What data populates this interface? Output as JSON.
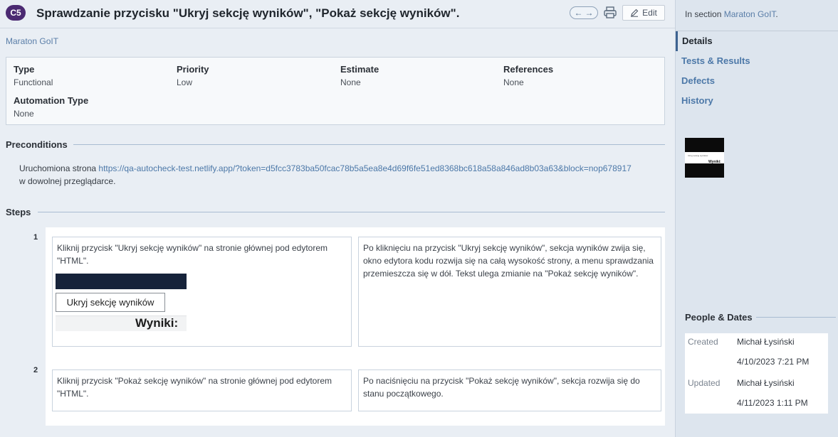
{
  "header": {
    "badge": "C5",
    "title": "Sprawdzanie przycisku \"Ukryj sekcję wyników\", \"Pokaż sekcję wyników\".",
    "edit_label": "Edit",
    "prev_arrow": "←",
    "next_arrow": "→"
  },
  "breadcrumb": "Maraton GoIT",
  "fields": {
    "type_label": "Type",
    "type_value": "Functional",
    "priority_label": "Priority",
    "priority_value": "Low",
    "estimate_label": "Estimate",
    "estimate_value": "None",
    "references_label": "References",
    "references_value": "None",
    "automation_label": "Automation Type",
    "automation_value": "None"
  },
  "preconditions": {
    "heading": "Preconditions",
    "text_before": "Uruchomiona strona ",
    "link": "https://qa-autocheck-test.netlify.app/?token=d5fcc3783ba50fcac78b5a5ea8e4d69f6fe51ed8368bc618a58a846ad8b03a63&block=nop678917",
    "text_after": " w dowolnej przeglądarce."
  },
  "steps": {
    "heading": "Steps",
    "items": [
      {
        "number": "1",
        "action": "Kliknij przycisk \"Ukryj sekcję wyników\" na stronie głównej pod edytorem \"HTML\".",
        "image_button": "Ukryj sekcję wyników",
        "image_label": "Wyniki:",
        "expected": "Po kliknięciu na przycisk \"Ukryj sekcję wyników\", sekcja wyników zwija się, okno edytora kodu rozwija się na całą wysokość strony, a menu sprawdzania przemieszcza się w dół. Tekst ulega zmianie na \"Pokaż sekcję wyników\"."
      },
      {
        "number": "2",
        "action": "Kliknij przycisk \"Pokaż sekcję wyników\" na stronie głównej pod edytorem \"HTML\".",
        "expected": "Po naciśnięciu na przycisk \"Pokaż sekcję wyników\", sekcja rozwija się do stanu początkowego."
      }
    ]
  },
  "sidebar": {
    "in_section_prefix": "In section ",
    "in_section_link": "Maraton GoIT",
    "in_section_suffix": ".",
    "nav": [
      "Details",
      "Tests & Results",
      "Defects",
      "History"
    ],
    "thumbnail_text_1": "Ukryj sekcję wyników",
    "thumbnail_text_2": "Wyniki:",
    "people_dates": {
      "heading": "People & Dates",
      "created_label": "Created",
      "created_by": "Michał Łysiński",
      "created_at": "4/10/2023 7:21 PM",
      "updated_label": "Updated",
      "updated_by": "Michał Łysiński",
      "updated_at": "4/11/2023 1:11 PM"
    }
  }
}
